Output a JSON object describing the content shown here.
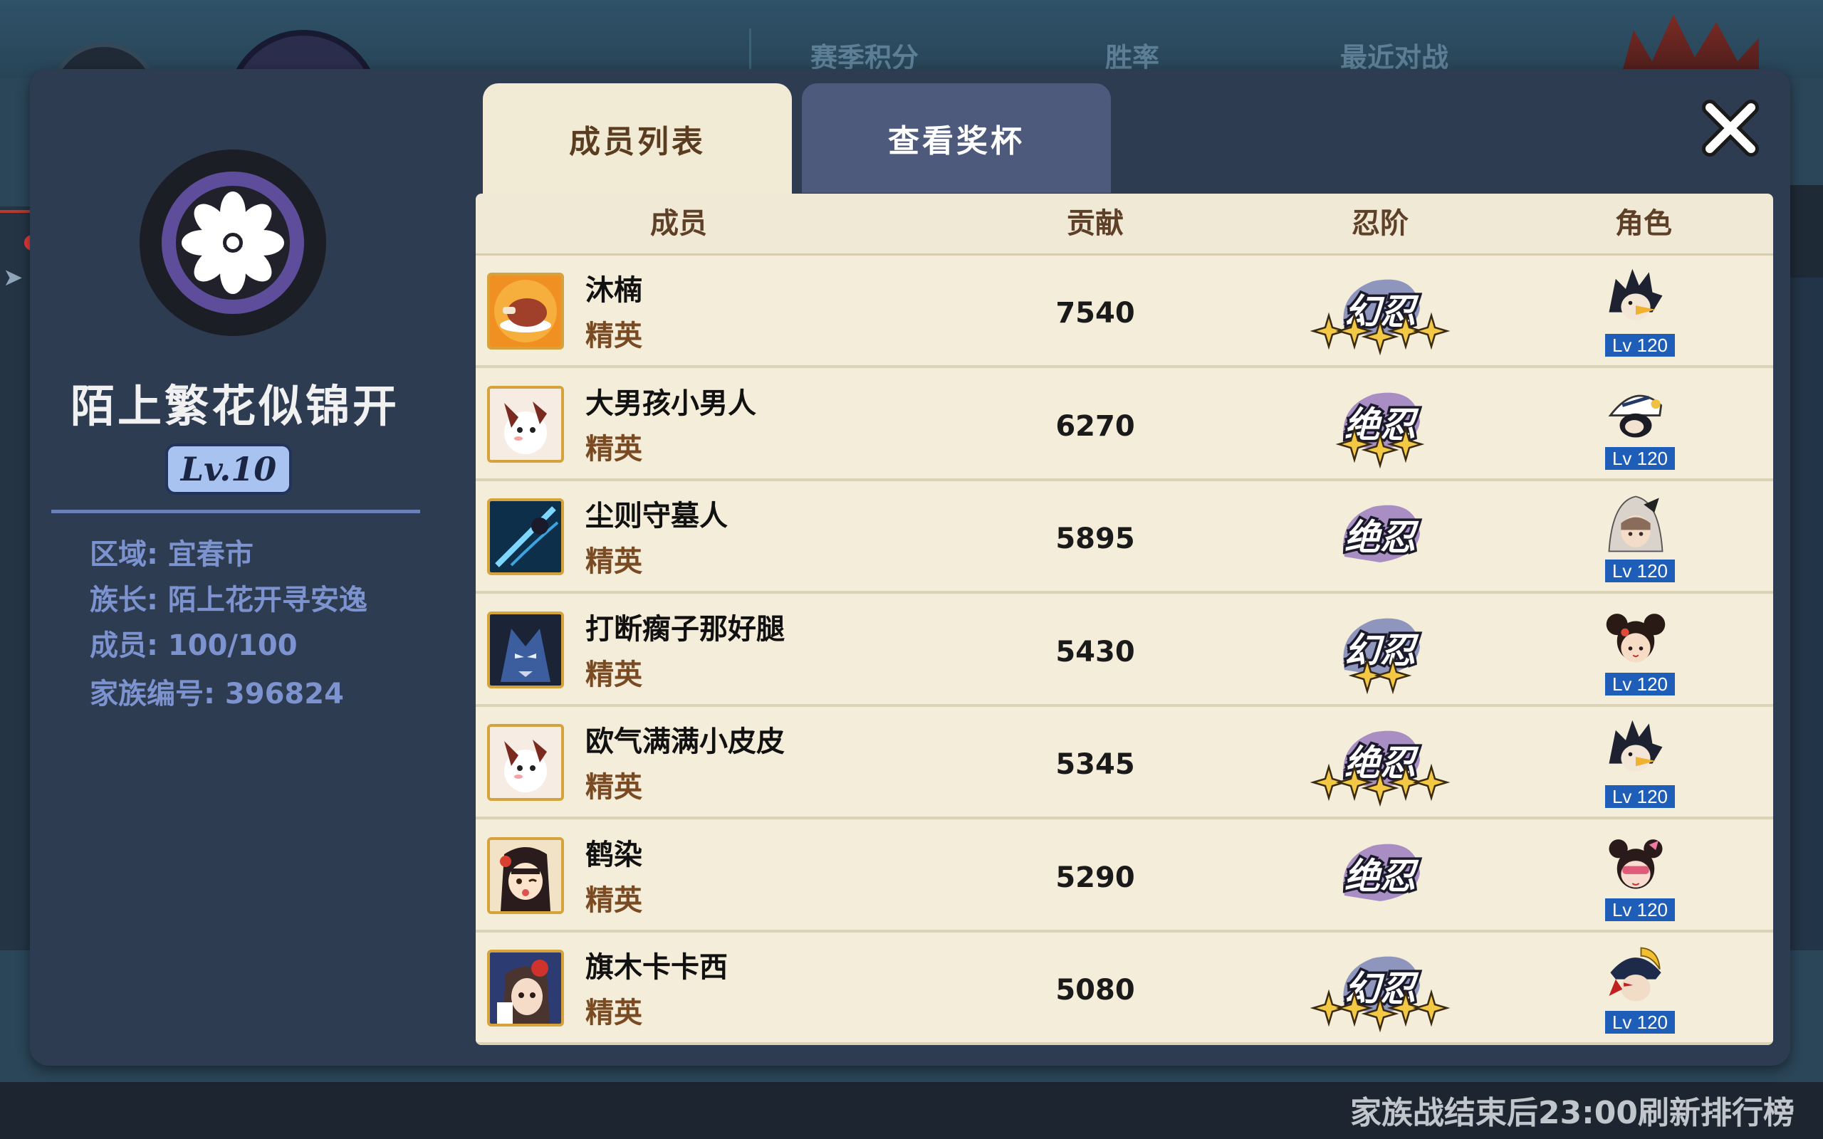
{
  "background": {
    "header_cols": [
      "赛季积分",
      "胜率",
      "最近对战"
    ],
    "footer_text": "家族战结束后23:00刷新排行榜"
  },
  "family": {
    "name": "陌上繁花似锦开",
    "level": "Lv.10",
    "region": "区域: 宜春市",
    "leader": "族长: 陌上花开寻安逸",
    "members": "成员: 100/100",
    "family_id": "家族编号: 396824"
  },
  "tabs": [
    {
      "label": "成员列表",
      "active": true
    },
    {
      "label": "查看奖杯",
      "active": false
    }
  ],
  "table": {
    "headers": [
      "成员",
      "贡献",
      "忍阶",
      "角色"
    ],
    "rows": [
      {
        "name": "沐楠",
        "role": "精英",
        "contribution": "7540",
        "rank": "幻忍",
        "stars": 5,
        "level": "Lv 120",
        "avatar": "meat-avatar",
        "character": "crow-ninja"
      },
      {
        "name": "大男孩小男人",
        "role": "精英",
        "contribution": "6270",
        "rank": "绝忍",
        "stars": 3,
        "level": "Lv 120",
        "avatar": "cat-avatar",
        "character": "white-cap-ninja"
      },
      {
        "name": "尘则守墓人",
        "role": "精英",
        "contribution": "5895",
        "rank": "绝忍",
        "stars": 0,
        "level": "Lv 120",
        "avatar": "blue-slash-avatar",
        "character": "hooded-girl"
      },
      {
        "name": "打断瘸子那好腿",
        "role": "精英",
        "contribution": "5430",
        "rank": "幻忍",
        "stars": 2,
        "level": "Lv 120",
        "avatar": "blue-demon-avatar",
        "character": "bun-hair-girl"
      },
      {
        "name": "欧气满满小皮皮",
        "role": "精英",
        "contribution": "5345",
        "rank": "绝忍",
        "stars": 5,
        "level": "Lv 120",
        "avatar": "cat-avatar",
        "character": "crow-ninja"
      },
      {
        "name": "鹤染",
        "role": "精英",
        "contribution": "5290",
        "rank": "绝忍",
        "stars": 0,
        "level": "Lv 120",
        "avatar": "girl-avatar",
        "character": "mask-girl"
      },
      {
        "name": "旗木卡卡西",
        "role": "精英",
        "contribution": "5080",
        "rank": "幻忍",
        "stars": 5,
        "level": "Lv 120",
        "avatar": "red-flower-girl-avatar",
        "character": "gold-helmet-ninja"
      }
    ]
  },
  "colors": {
    "panel": "#2e3c52",
    "table_bg": "#efe9d5",
    "rank_huan": "#3c4fa8",
    "rank_jue": "#6a3fb0",
    "star": "#f2c845",
    "level_badge": "#1f5eb8"
  }
}
